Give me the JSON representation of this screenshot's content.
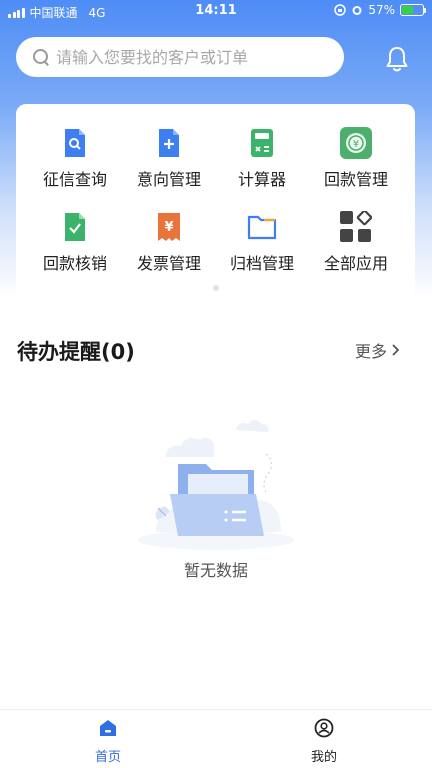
{
  "status_bar": {
    "carrier": "中国联通",
    "network": "4G",
    "time": "14:11",
    "battery_percent": "57%",
    "battery_level": 0.57
  },
  "search": {
    "placeholder": "请输入您要找的客户或订单",
    "icon": "search-icon"
  },
  "header": {
    "bell_icon": "bell-icon"
  },
  "apps": [
    {
      "label": "征信查询",
      "icon": "credit-search-icon",
      "color": "#3d7ef0"
    },
    {
      "label": "意向管理",
      "icon": "add-document-icon",
      "color": "#3d7ef0"
    },
    {
      "label": "计算器",
      "icon": "calculator-icon",
      "color": "#3bb36a"
    },
    {
      "label": "回款管理",
      "icon": "payment-icon",
      "color": "#4caf6e"
    },
    {
      "label": "回款核销",
      "icon": "check-document-icon",
      "color": "#3bb36a"
    },
    {
      "label": "发票管理",
      "icon": "invoice-icon",
      "color": "#e8743b"
    },
    {
      "label": "归档管理",
      "icon": "folder-icon",
      "color": "#3d7ef0"
    },
    {
      "label": "全部应用",
      "icon": "all-apps-icon",
      "color": "#444444"
    }
  ],
  "todo": {
    "title": "待办提醒(0)",
    "more_label": "更多",
    "empty_text": "暂无数据"
  },
  "tabbar": {
    "tabs": [
      {
        "label": "首页",
        "icon": "home-icon",
        "active": true,
        "color": "#2f6fe4"
      },
      {
        "label": "我的",
        "icon": "profile-icon",
        "active": false,
        "color": "#222222"
      }
    ]
  }
}
